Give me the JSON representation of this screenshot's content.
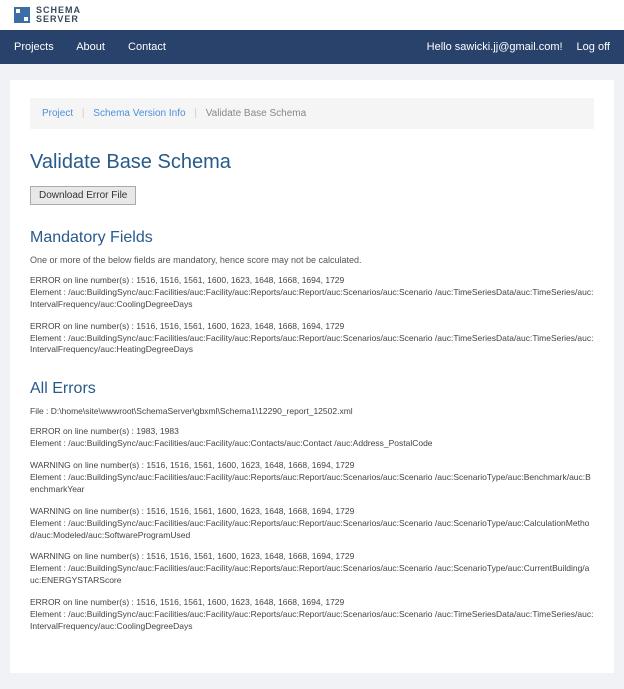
{
  "logo": {
    "line1": "SCHEMA",
    "line2": "SERVER"
  },
  "nav": {
    "projects": "Projects",
    "about": "About",
    "contact": "Contact",
    "greeting": "Hello sawicki.jj@gmail.com!",
    "logoff": "Log off"
  },
  "breadcrumb": {
    "project": "Project",
    "version": "Schema Version Info",
    "current": "Validate Base Schema"
  },
  "page": {
    "title": "Validate Base Schema",
    "download_btn": "Download Error File"
  },
  "mandatory": {
    "heading": "Mandatory Fields",
    "note": "One or more of the below fields are mandatory, hence score may not be calculated.",
    "errors": [
      {
        "line": "ERROR on line number(s) : 1516, 1516, 1561, 1600, 1623, 1648, 1668, 1694, 1729",
        "element": "Element : /auc:BuildingSync/auc:Facilities/auc:Facility/auc:Reports/auc:Report/auc:Scenarios/auc:Scenario /auc:TimeSeriesData/auc:TimeSeries/auc:IntervalFrequency/auc:CoolingDegreeDays"
      },
      {
        "line": "ERROR on line number(s) : 1516, 1516, 1561, 1600, 1623, 1648, 1668, 1694, 1729",
        "element": "Element : /auc:BuildingSync/auc:Facilities/auc:Facility/auc:Reports/auc:Report/auc:Scenarios/auc:Scenario /auc:TimeSeriesData/auc:TimeSeries/auc:IntervalFrequency/auc:HeatingDegreeDays"
      }
    ]
  },
  "all_errors": {
    "heading": "All Errors",
    "file": "File : D:\\home\\site\\wwwroot\\SchemaServer\\gbxml\\Schema1\\12290_report_12502.xml",
    "items": [
      {
        "line": "ERROR on line number(s) : 1983, 1983",
        "element": "Element : /auc:BuildingSync/auc:Facilities/auc:Facility/auc:Contacts/auc:Contact /auc:Address_PostalCode"
      },
      {
        "line": "WARNING on line number(s) : 1516, 1516, 1561, 1600, 1623, 1648, 1668, 1694, 1729",
        "element": "Element : /auc:BuildingSync/auc:Facilities/auc:Facility/auc:Reports/auc:Report/auc:Scenarios/auc:Scenario /auc:ScenarioType/auc:Benchmark/auc:BenchmarkYear"
      },
      {
        "line": "WARNING on line number(s) : 1516, 1516, 1561, 1600, 1623, 1648, 1668, 1694, 1729",
        "element": "Element : /auc:BuildingSync/auc:Facilities/auc:Facility/auc:Reports/auc:Report/auc:Scenarios/auc:Scenario /auc:ScenarioType/auc:CalculationMethod/auc:Modeled/auc:SoftwareProgramUsed"
      },
      {
        "line": "WARNING on line number(s) : 1516, 1516, 1561, 1600, 1623, 1648, 1668, 1694, 1729",
        "element": "Element : /auc:BuildingSync/auc:Facilities/auc:Facility/auc:Reports/auc:Report/auc:Scenarios/auc:Scenario /auc:ScenarioType/auc:CurrentBuilding/auc:ENERGYSTARScore"
      },
      {
        "line": "ERROR on line number(s) : 1516, 1516, 1561, 1600, 1623, 1648, 1668, 1694, 1729",
        "element": "Element : /auc:BuildingSync/auc:Facilities/auc:Facility/auc:Reports/auc:Report/auc:Scenarios/auc:Scenario /auc:TimeSeriesData/auc:TimeSeries/auc:IntervalFrequency/auc:CoolingDegreeDays"
      }
    ]
  }
}
